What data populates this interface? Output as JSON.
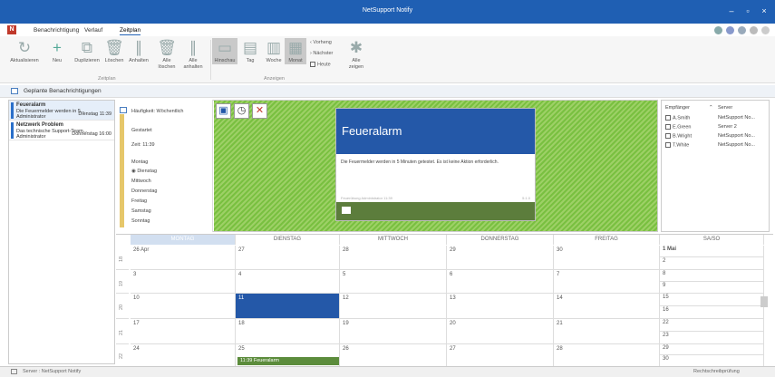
{
  "window": {
    "title": "NetSupport Notify"
  },
  "menu": {
    "items": [
      "Benachrichtigung",
      "Verlauf",
      "Zeitplan"
    ],
    "active": "Zeitplan"
  },
  "ribbon": {
    "buttons": {
      "refresh": "Aktualisieren",
      "new": "Neu",
      "duplicate": "Duplizieren",
      "delete": "Löschen",
      "stop": "Anhalten",
      "delete_all": "Alle löschen",
      "stop_all": "Alle anhalten",
      "preview": "Hinschau",
      "day": "Tag",
      "week": "Woche",
      "month": "Monat",
      "prev": "Vorheng",
      "next": "Nächster",
      "today": "Heute",
      "show_all": "Alle zeigen"
    },
    "groups": {
      "schedules": "Zeitplan",
      "views": "Anzeigen"
    }
  },
  "subbar": {
    "label": "Geplante Benachrichtigungen"
  },
  "list": [
    {
      "title": "Feueralarm",
      "line2": "Die Feuermelder werden in 5...",
      "author": "Administrator",
      "when": "Dienstag 11:39",
      "color": "#2a6fc9"
    },
    {
      "title": "Netzwerk Problem",
      "line2": "Das technische Support-Team...",
      "author": "Administrator",
      "when": "Donnerstag 16:00",
      "color": "#2a6fc9"
    }
  ],
  "details": {
    "frequency": "Häufigkeit: Wöchentlich",
    "started": "Gestartet",
    "time": "Zeit: 11:39",
    "days": [
      "Montag",
      "Dienstag",
      "Mittwoch",
      "Donnerstag",
      "Freitag",
      "Samstag",
      "Sonntag"
    ],
    "selected_day": "Dienstag"
  },
  "message": {
    "title": "Feueralarm",
    "body": "Die Feuermelder werden in 5 Minuten getestet. Es ist keine Aktion erforderlich.",
    "footer_left": "Feuerübung Administrator 11:39",
    "footer_right": "5.1.0"
  },
  "recipients": {
    "headers": [
      "Empfänger",
      "Server"
    ],
    "rows": [
      {
        "name": "A.Smith",
        "server": "NetSupport No..."
      },
      {
        "name": "E.Green",
        "server": "Server 2"
      },
      {
        "name": "B.Wright",
        "server": "NetSupport No..."
      },
      {
        "name": "T.White",
        "server": "NetSupport No..."
      }
    ]
  },
  "calendar": {
    "days": [
      "MONTAG",
      "DIENSTAG",
      "MITTWOCH",
      "DONNERSTAG",
      "FREITAG",
      "SA/SO"
    ],
    "weeks": [
      "18",
      "19",
      "20",
      "21",
      "22"
    ],
    "rows": [
      [
        "26 Apr",
        "27",
        "28",
        "29",
        "30",
        "1 Mai",
        "2"
      ],
      [
        "3",
        "4",
        "5",
        "6",
        "7",
        "8",
        "9"
      ],
      [
        "10",
        "11",
        "12",
        "13",
        "14",
        "15",
        "16"
      ],
      [
        "17",
        "18",
        "19",
        "20",
        "21",
        "22",
        "23"
      ],
      [
        "24",
        "25",
        "26",
        "27",
        "28",
        "29",
        "30"
      ]
    ],
    "event": "11:39 Feueralarm",
    "event_color": "#5c8c3c",
    "selected_color": "#2458a8"
  },
  "status": {
    "left": "Server : NetSupport Notify",
    "right": "Rechtschreibprüfung"
  }
}
